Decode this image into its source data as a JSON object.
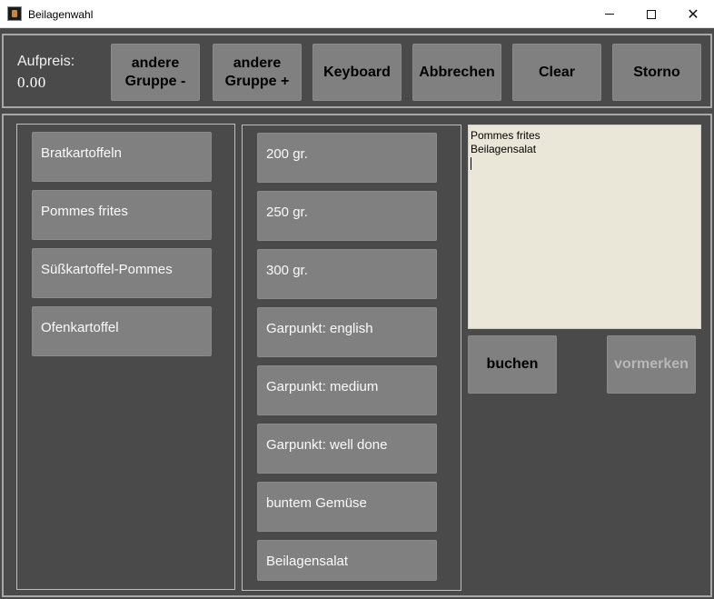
{
  "window": {
    "title": "Beilagenwahl",
    "controls": {
      "minimize": "minimize-icon",
      "maximize": "maximize-icon",
      "close": "close-icon"
    }
  },
  "header": {
    "aufpreis_label": "Aufpreis:",
    "aufpreis_value": "0.00",
    "buttons": {
      "prev_group": "andere\nGruppe -",
      "next_group": "andere\nGruppe +",
      "keyboard": "Keyboard",
      "cancel": "Abbrechen",
      "clear": "Clear",
      "storno": "Storno"
    }
  },
  "sides": {
    "items": [
      "Bratkartoffeln",
      "Pommes frites",
      "Süßkartoffel-Pommes",
      "Ofenkartoffel"
    ]
  },
  "options": {
    "items": [
      "200 gr.",
      "250 gr.",
      "300 gr.",
      "Garpunkt: english",
      "Garpunkt: medium",
      "Garpunkt: well done",
      "buntem Gemüse",
      "Beilagensalat"
    ]
  },
  "selection": {
    "lines": [
      "Pommes frites",
      "Beilagensalat"
    ]
  },
  "actions": {
    "book": "buchen",
    "reserve": "vormerken"
  },
  "colors": {
    "background": "#4a4a4a",
    "button": "#808080",
    "text_area": "#ebe7d8",
    "disabled_text": "#b8b8b8"
  }
}
